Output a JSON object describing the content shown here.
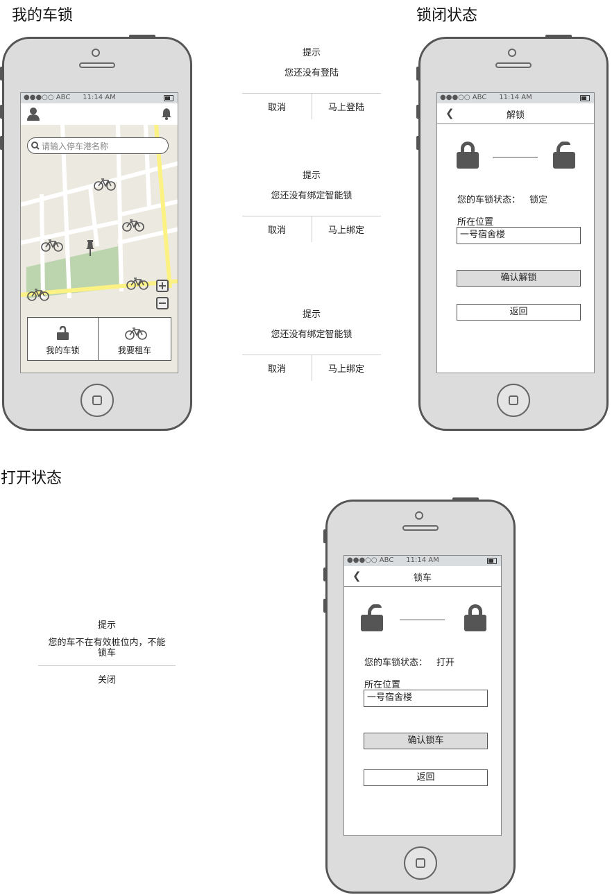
{
  "sections": {
    "my_lock": "我的车锁",
    "locked_state": "锁闭状态",
    "open_state": "打开状态"
  },
  "status_bar": {
    "signal": "●●●○○ ABC",
    "time": "11:14 AM"
  },
  "home_screen": {
    "search_placeholder": "请输入停车港名称",
    "tab_my_lock": "我的车锁",
    "tab_rent": "我要租车"
  },
  "dialogs": {
    "login": {
      "title": "提示",
      "message": "您还没有登陆",
      "cancel": "取消",
      "confirm": "马上登陆"
    },
    "bind1": {
      "title": "提示",
      "message": "您还没有绑定智能锁",
      "cancel": "取消",
      "confirm": "马上绑定"
    },
    "bind2": {
      "title": "提示",
      "message": "您还没有绑定智能锁",
      "cancel": "取消",
      "confirm": "马上绑定"
    },
    "not_in_zone": {
      "title": "提示",
      "message": "您的车不在有效桩位内，不能锁车",
      "close": "关闭"
    }
  },
  "unlock_screen": {
    "nav_title": "解锁",
    "status_label": "您的车锁状态：",
    "status_value": "锁定",
    "location_label": "所在位置",
    "location_value": "一号宿舍楼",
    "confirm_button": "确认解锁",
    "back_button": "返回"
  },
  "lock_screen": {
    "nav_title": "锁车",
    "status_label": "您的车锁状态：",
    "status_value": "打开",
    "location_label": "所在位置",
    "location_value": "一号宿舍楼",
    "confirm_button": "确认锁车",
    "back_button": "返回"
  },
  "colors": {
    "map_bg": "#ece9e1",
    "park": "#bcd5ae",
    "road_yellow": "#fcf283",
    "gray_button": "#dcdcdc"
  }
}
